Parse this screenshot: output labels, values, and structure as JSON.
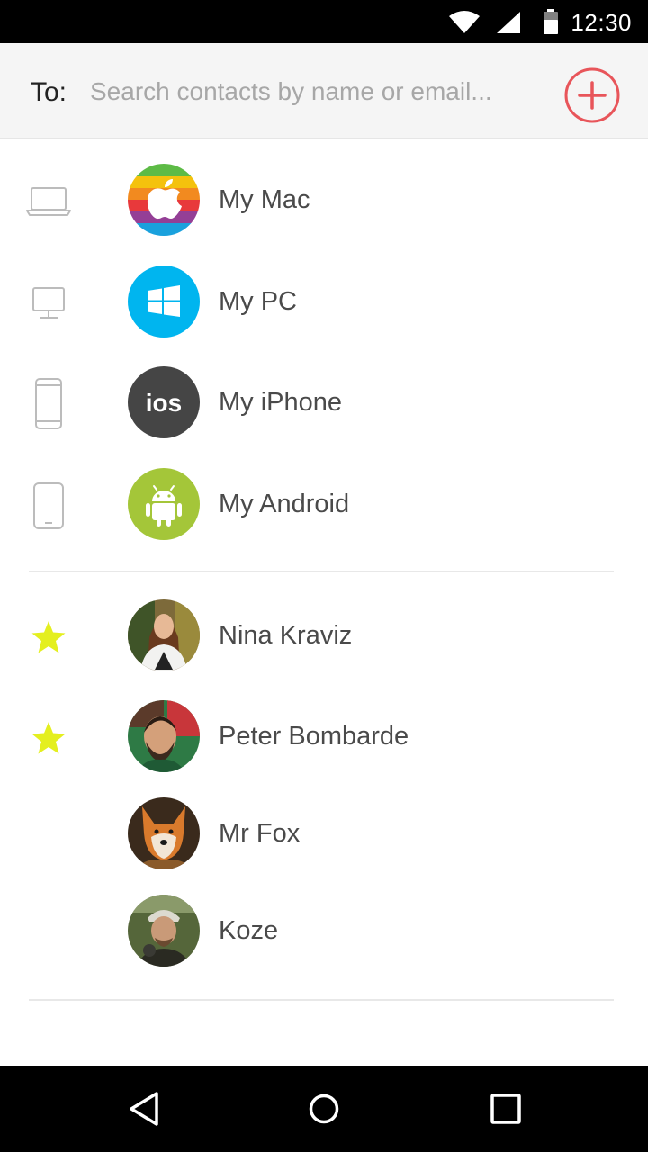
{
  "status_bar": {
    "time": "12:30"
  },
  "compose": {
    "to_label": "To:",
    "search_placeholder": "Search contacts by name or email...",
    "accent_color": "#e8555a"
  },
  "devices": [
    {
      "name": "My Mac",
      "type_icon": "laptop-icon",
      "avatar_icon": "apple-logo-icon"
    },
    {
      "name": "My PC",
      "type_icon": "desktop-icon",
      "avatar_icon": "windows-logo-icon"
    },
    {
      "name": "My iPhone",
      "type_icon": "phone-icon",
      "avatar_icon": "ios-logo-icon",
      "avatar_text": "ios"
    },
    {
      "name": "My Android",
      "type_icon": "tablet-icon",
      "avatar_icon": "android-logo-icon"
    }
  ],
  "contacts": [
    {
      "name": "Nina Kraviz",
      "favorite": true
    },
    {
      "name": "Peter Bombarde",
      "favorite": true
    },
    {
      "name": "Mr Fox",
      "favorite": false
    },
    {
      "name": "Koze",
      "favorite": false
    }
  ],
  "colors": {
    "favorite_star": "#e4ef1f",
    "device_icon": "#bcbcbc"
  }
}
